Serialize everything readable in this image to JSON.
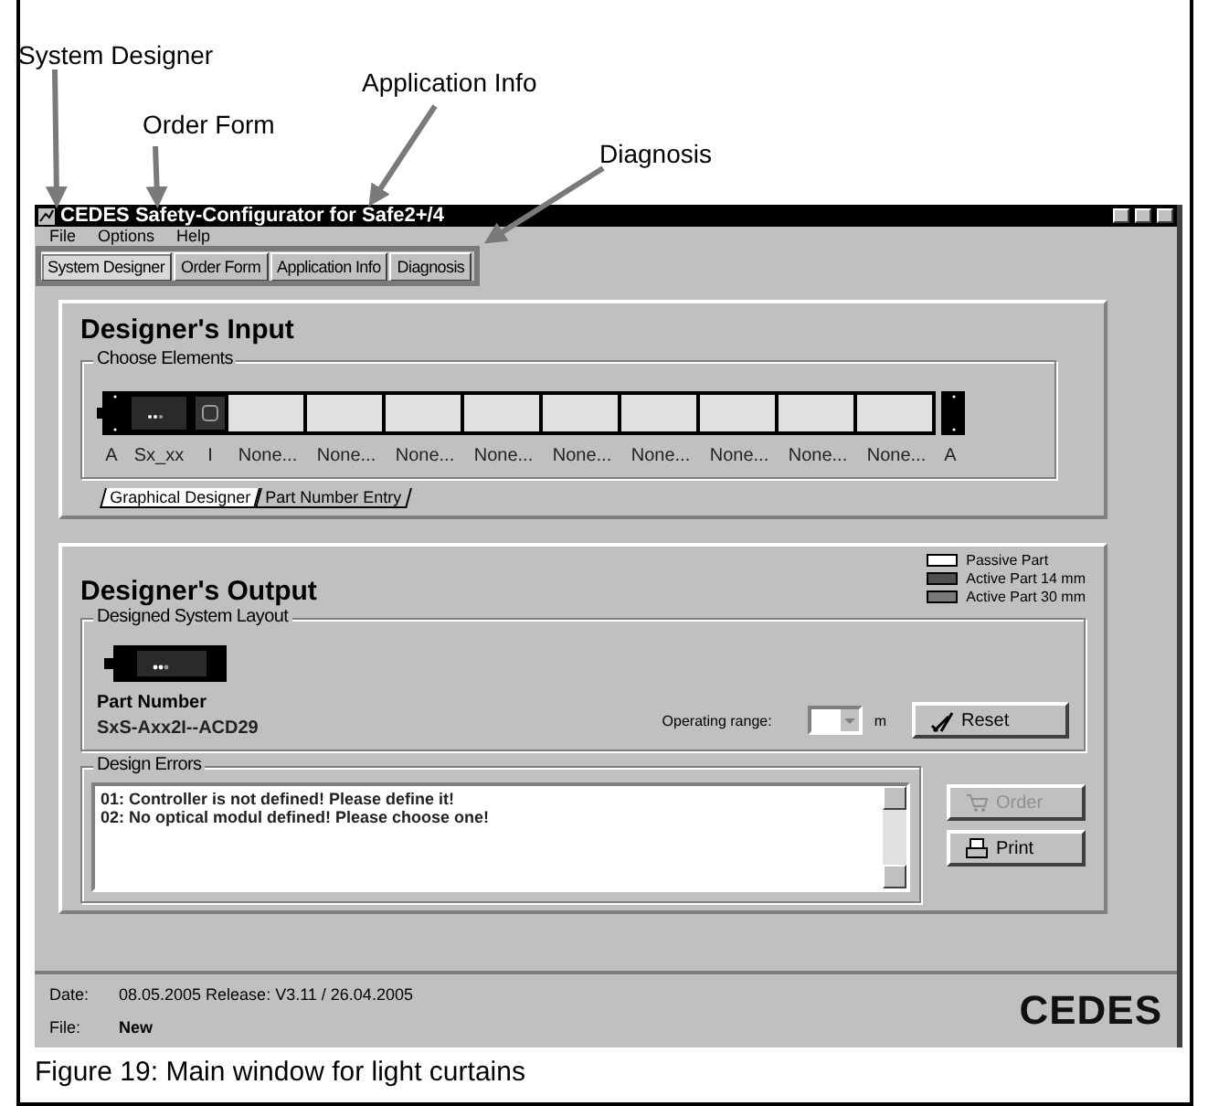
{
  "annotations": [
    {
      "label": "System Designer"
    },
    {
      "label": "Order Form"
    },
    {
      "label": "Application Info"
    },
    {
      "label": "Diagnosis"
    }
  ],
  "window": {
    "title": "CEDES Safety-Configurator for Safe2+/4"
  },
  "menu": [
    "File",
    "Options",
    "Help"
  ],
  "tabs": [
    {
      "label": "System Designer",
      "selected": true
    },
    {
      "label": "Order Form",
      "selected": false
    },
    {
      "label": "Application Info",
      "selected": false
    },
    {
      "label": "Diagnosis",
      "selected": false
    }
  ],
  "designers_input": {
    "title": "Designer's Input",
    "group": "Choose Elements",
    "elements": [
      {
        "kind": "end",
        "label": "A"
      },
      {
        "kind": "controller",
        "label": "Sx_xx"
      },
      {
        "kind": "interface",
        "label": "I"
      },
      {
        "kind": "empty",
        "label": "None..."
      },
      {
        "kind": "empty",
        "label": "None..."
      },
      {
        "kind": "empty",
        "label": "None..."
      },
      {
        "kind": "empty",
        "label": "None..."
      },
      {
        "kind": "empty",
        "label": "None..."
      },
      {
        "kind": "empty",
        "label": "None..."
      },
      {
        "kind": "empty",
        "label": "None..."
      },
      {
        "kind": "empty",
        "label": "None..."
      },
      {
        "kind": "empty",
        "label": "None..."
      },
      {
        "kind": "end",
        "label": "A"
      }
    ],
    "subtabs": [
      {
        "label": "Graphical Designer",
        "selected": true
      },
      {
        "label": "Part Number Entry",
        "selected": false
      }
    ]
  },
  "designers_output": {
    "title": "Designer's Output",
    "legend": [
      {
        "label": "Passive Part",
        "color": "#ffffff"
      },
      {
        "label": "Active Part 14 mm",
        "color": "#505050"
      },
      {
        "label": "Active Part 30 mm",
        "color": "#7a7a7a"
      }
    ],
    "layout_group": "Designed System Layout",
    "part_number_label": "Part Number",
    "part_number": "SxS-Axx2I--ACD29",
    "operating_range_label": "Operating range:",
    "unit": "m",
    "reset_button": "Reset",
    "errors_group": "Design Errors",
    "errors": [
      "01: Controller is not defined! Please define it!",
      "02: No optical modul defined! Please choose one!"
    ],
    "order_button": {
      "label": "Order",
      "disabled": true
    },
    "print_button": {
      "label": "Print",
      "disabled": false
    }
  },
  "status_bar": {
    "date_label": "Date:",
    "date_value": "08.05.2005  Release: V3.11 / 26.04.2005",
    "file_label": "File:",
    "file_value": "New",
    "logo": "CEDES"
  },
  "caption": "Figure 19: Main window for light curtains"
}
